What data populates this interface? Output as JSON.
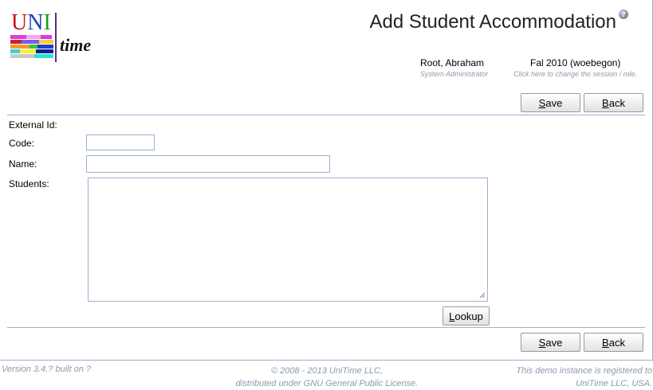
{
  "logo": {
    "uni_u": "U",
    "uni_n": "N",
    "uni_i": "I",
    "time": "time"
  },
  "header": {
    "title": "Add Student Accommodation",
    "help_glyph": "?",
    "user_name": "Root, Abraham",
    "user_role": "System Administrator",
    "session": "Fal 2010 (woebegon)",
    "session_hint": "Click here to change the session / role."
  },
  "toolbar_top": {
    "save_label": "ave",
    "save_key": "S",
    "back_label": "ack",
    "back_key": "B"
  },
  "form": {
    "external_id_label": "External Id:",
    "code_label": "Code:",
    "code_value": "",
    "name_label": "Name:",
    "name_value": "",
    "students_label": "Students:",
    "students_value": "",
    "lookup_key": "L",
    "lookup_label": "ookup"
  },
  "toolbar_bottom": {
    "save_label": "ave",
    "save_key": "S",
    "back_label": "ack",
    "back_key": "B"
  },
  "footer": {
    "version": "Version 3.4.? built on ?",
    "copyright_line1": "© 2008 - 2013 UniTime LLC,",
    "copyright_line2": "distributed under GNU General Public License.",
    "registered_line1": "This demo instance is registered to",
    "registered_line2": "UniTime LLC, USA."
  },
  "colors": {
    "border": "#9cb0ce",
    "muted_text": "#8c9aac",
    "logo_bar": "#5a2a80"
  }
}
